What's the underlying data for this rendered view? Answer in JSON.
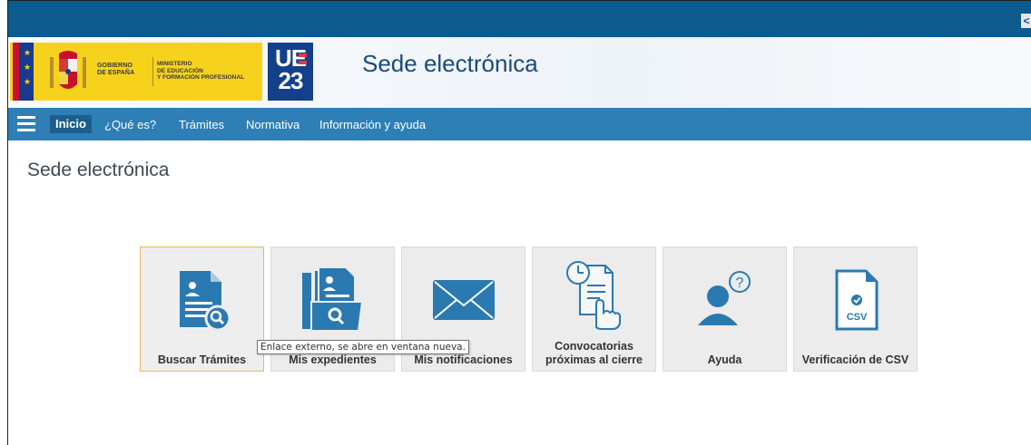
{
  "colors": {
    "topbar": "#0d5a8f",
    "nav": "#2d7fb6",
    "icon_blue": "#2a79b1",
    "gov_yellow": "#f6d21d"
  },
  "header": {
    "gov_line1": "GOBIERNO",
    "gov_line2": "DE ESPAÑA",
    "ministry_line1": "MINISTERIO",
    "ministry_line2": "DE EDUCACIÓN",
    "ministry_line3": "Y FORMACIÓN PROFESIONAL",
    "eu_logo_top": "UE",
    "eu_logo_bottom": "23",
    "site_title": "Sede electrónica"
  },
  "topbar": {
    "toggle_glyph": "<"
  },
  "nav": {
    "items": [
      {
        "label": "Inicio",
        "active": true
      },
      {
        "label": "¿Qué es?"
      },
      {
        "label": "Trámites"
      },
      {
        "label": "Normativa"
      },
      {
        "label": "Información y ayuda"
      }
    ]
  },
  "page": {
    "title": "Sede electrónica"
  },
  "tiles": [
    {
      "label": "Buscar Trámites",
      "icon": "search-document-icon"
    },
    {
      "label": "Mis expedientes",
      "icon": "folder-search-icon"
    },
    {
      "label": "Mis notificaciones",
      "icon": "envelope-icon"
    },
    {
      "label": "Convocatorias próximas al cierre",
      "icon": "clock-document-hand-icon"
    },
    {
      "label": "Ayuda",
      "icon": "user-question-icon"
    },
    {
      "label": "Verificación de CSV",
      "icon": "csv-document-icon",
      "icon_text": "CSV"
    }
  ],
  "tooltip": {
    "text": "Enlace externo, se abre en ventana nueva."
  }
}
